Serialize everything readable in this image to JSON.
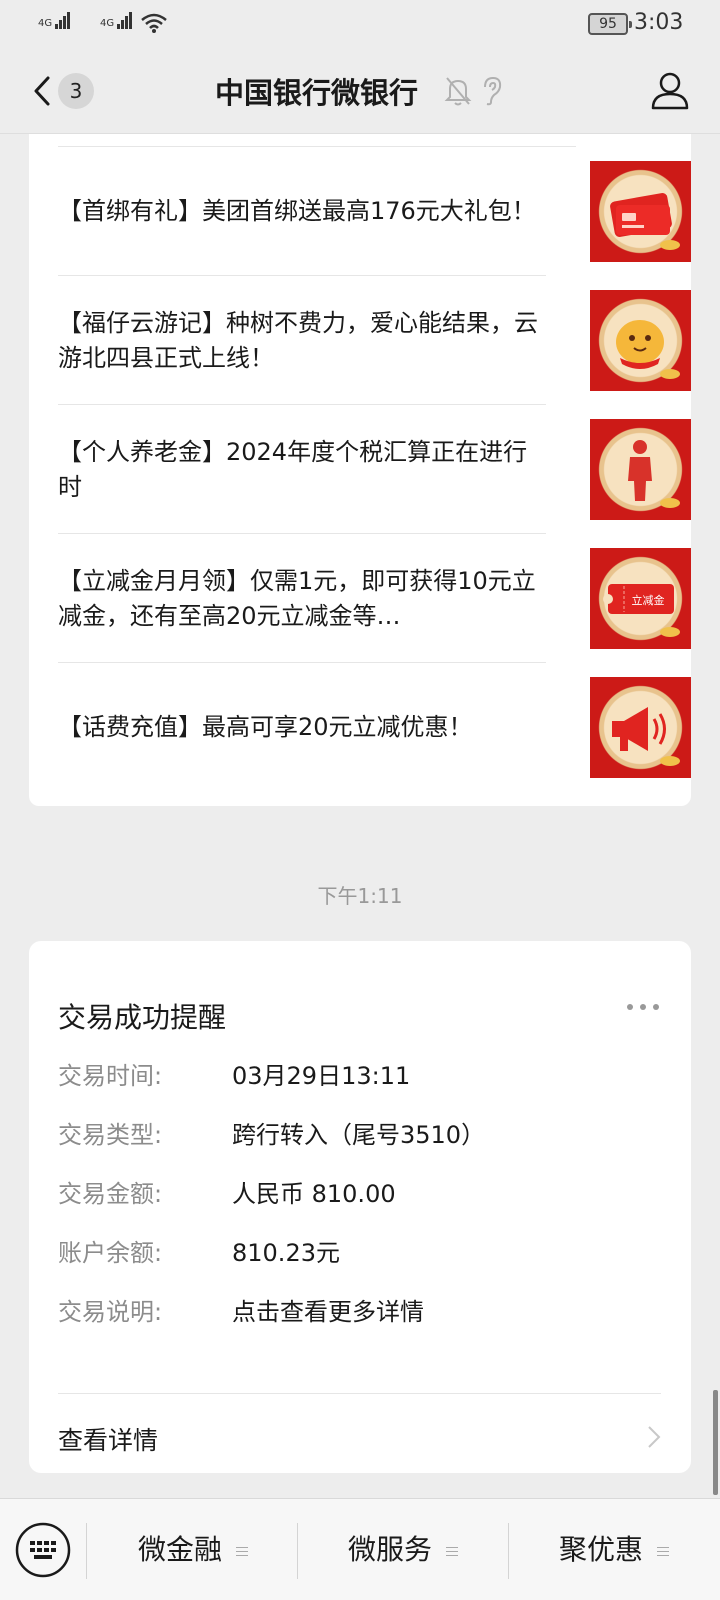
{
  "status_bar": {
    "sim1_label": "4G",
    "sim2_label": "4G",
    "battery": "95",
    "time": "3:03"
  },
  "header": {
    "unread_count": "3",
    "title": "中国银行微银行"
  },
  "articles": [
    {
      "text": "【首绑有礼】美团首绑送最高176元大礼包！",
      "icon": "credit-card-icon"
    },
    {
      "text": "【福仔云游记】种树不费力，爱心能结果，云游北四县正式上线！",
      "icon": "mascot-icon"
    },
    {
      "text": "【个人养老金】2024年度个税汇算正在进行时",
      "icon": "person-icon"
    },
    {
      "text": "【立减金月月领】仅需1元，即可获得10元立减金，还有至高20元立减金等…",
      "icon": "coupon-icon",
      "thumb_label": "立减金"
    },
    {
      "text": "【话费充值】最高可享20元立减优惠！",
      "icon": "megaphone-icon"
    }
  ],
  "message_time": "下午1:11",
  "transaction": {
    "title": "交易成功提醒",
    "rows": [
      {
        "label": "交易时间:",
        "value": "03月29日13:11"
      },
      {
        "label": "交易类型:",
        "value": "跨行转入（尾号3510）"
      },
      {
        "label": "交易金额:",
        "value": "人民币 810.00"
      },
      {
        "label": "账户余额:",
        "value": "810.23元"
      },
      {
        "label": "交易说明:",
        "value": "点击查看更多详情"
      }
    ],
    "detail_link": "查看详情"
  },
  "bottom_menu": {
    "items": [
      "微金融",
      "微服务",
      "聚优惠"
    ]
  },
  "colors": {
    "background": "#ededed",
    "card": "#ffffff",
    "thumb_red": "#cc1a17"
  }
}
